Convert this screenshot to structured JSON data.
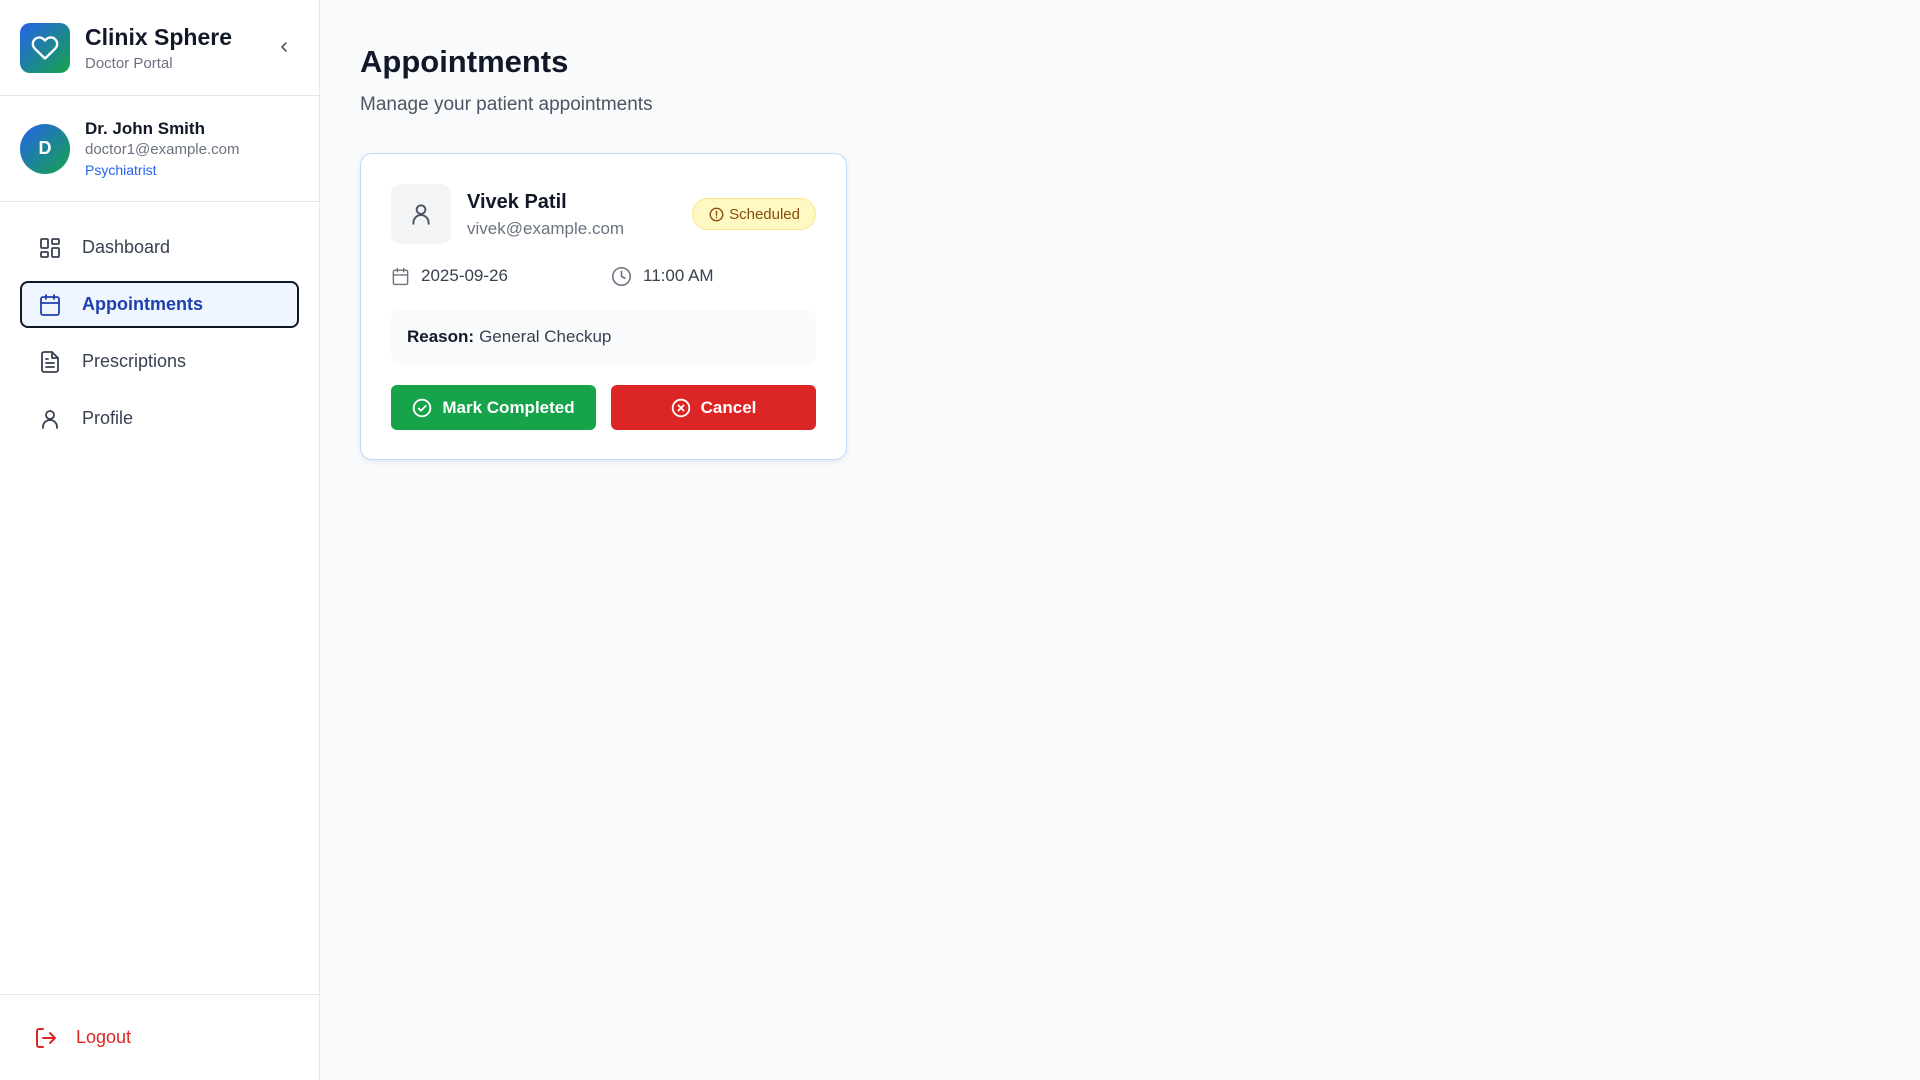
{
  "brand": {
    "title": "Clinix Sphere",
    "subtitle": "Doctor Portal"
  },
  "user": {
    "initial": "D",
    "name": "Dr. John Smith",
    "email": "doctor1@example.com",
    "role": "Psychiatrist"
  },
  "nav": {
    "items": [
      {
        "label": "Dashboard",
        "icon": "dashboard-icon"
      },
      {
        "label": "Appointments",
        "icon": "calendar-icon",
        "active": true
      },
      {
        "label": "Prescriptions",
        "icon": "document-icon"
      },
      {
        "label": "Profile",
        "icon": "user-icon"
      }
    ],
    "logout_label": "Logout"
  },
  "main": {
    "title": "Appointments",
    "subtitle": "Manage your patient appointments"
  },
  "appointment": {
    "patient_name": "Vivek Patil",
    "patient_email": "vivek@example.com",
    "status": "Scheduled",
    "date": "2025-09-26",
    "time": "11:00 AM",
    "reason_label": "Reason:",
    "reason": "General Checkup",
    "complete_label": "Mark Completed",
    "cancel_label": "Cancel"
  },
  "colors": {
    "accent": "#2563eb",
    "success": "#16a34a",
    "danger": "#dc2626",
    "warning_bg": "#fef9c3"
  }
}
